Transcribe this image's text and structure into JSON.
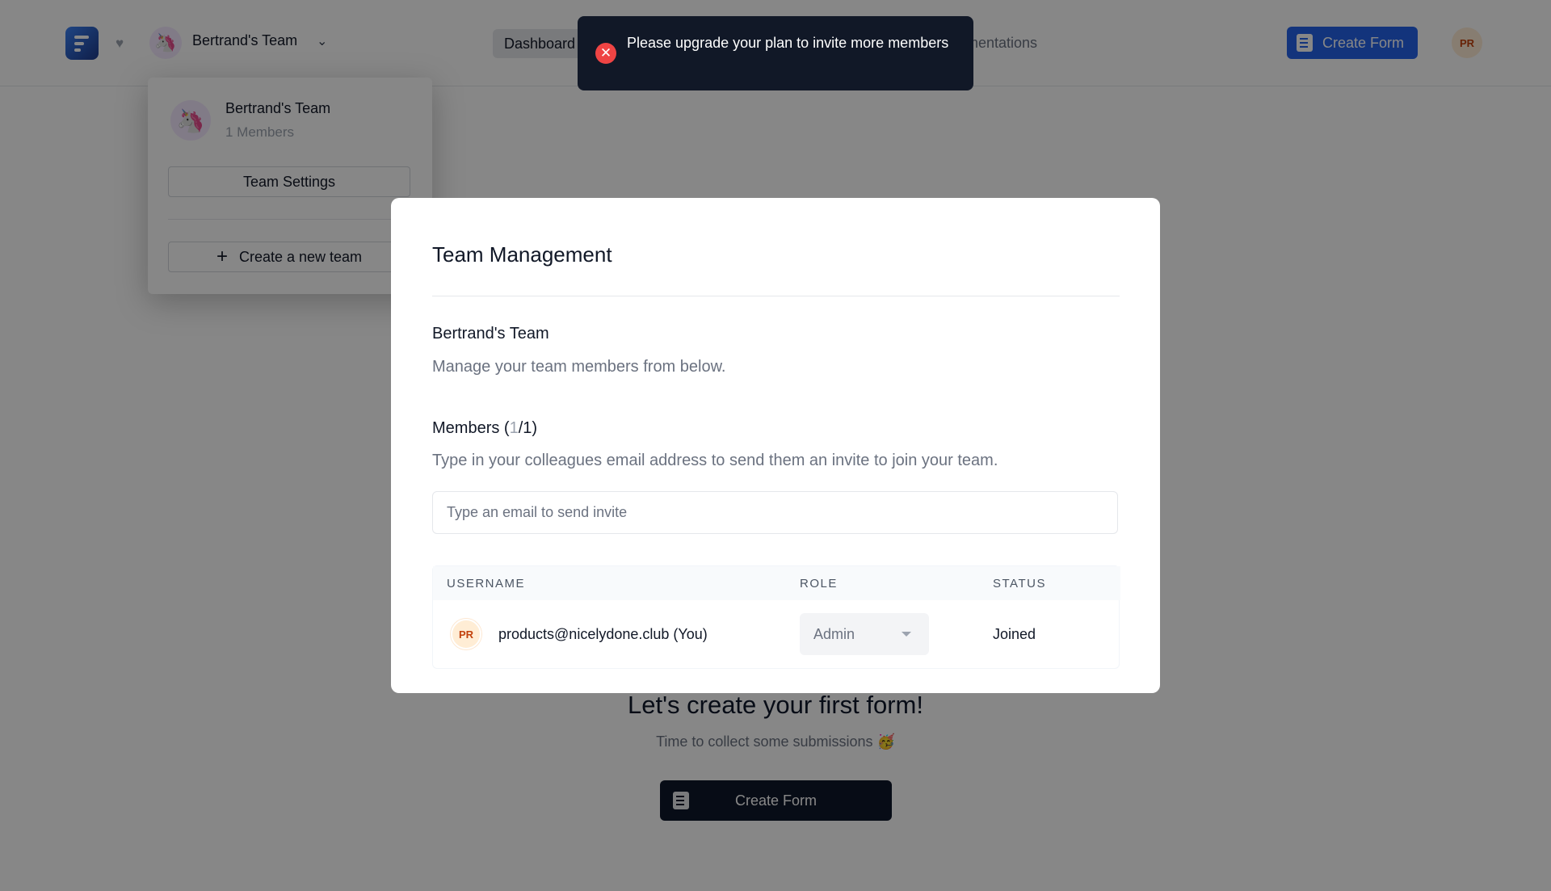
{
  "header": {
    "team_name": "Bertrand's Team",
    "nav_dashboard": "Dashboard",
    "nav_docs": "mentations",
    "create_form_label": "Create Form",
    "user_initials": "PR"
  },
  "dropdown": {
    "team_name": "Bertrand's Team",
    "member_count": "1 Members",
    "settings_label": "Team Settings",
    "create_team_label": "Create a new team"
  },
  "empty_state": {
    "title": "Let's create your first form!",
    "subtitle": "Time to collect some submissions 🥳",
    "button_label": "Create Form"
  },
  "modal": {
    "title": "Team Management",
    "team_name": "Bertrand's Team",
    "team_description": "Manage your team members from below.",
    "members_prefix": "Members (",
    "members_current": "1",
    "members_suffix": "/1)",
    "members_description": "Type in your colleagues email address to send them an invite to join your team.",
    "invite_placeholder": "Type an email to send invite",
    "invite_value": "",
    "table": {
      "headers": [
        "USERNAME",
        "ROLE",
        "STATUS"
      ],
      "rows": [
        {
          "initials": "PR",
          "username": "products@nicelydone.club (You)",
          "role": "Admin",
          "status": "Joined"
        }
      ]
    }
  },
  "toast": {
    "message": "Please upgrade your plan to invite more members",
    "type": "error"
  },
  "colors": {
    "primary": "#2563eb",
    "error": "#ef4444",
    "dark": "#111827"
  }
}
